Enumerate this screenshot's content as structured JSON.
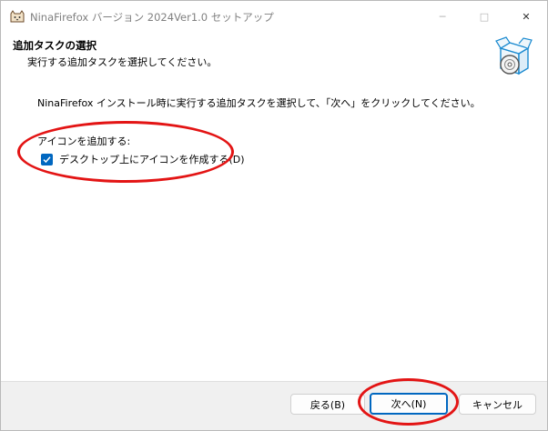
{
  "window": {
    "title": "NinaFirefox バージョン 2024Ver1.0 セットアップ",
    "app_icon": "cat-app-icon",
    "controls": {
      "minimize": "─",
      "maximize": "□",
      "close": "✕"
    }
  },
  "header": {
    "title": "追加タスクの選択",
    "subtitle": "実行する追加タスクを選択してください。",
    "icon": "setup-box-disc-icon"
  },
  "content": {
    "instruction": "NinaFirefox インストール時に実行する追加タスクを選択して、「次へ」をクリックしてください。",
    "group_label": "アイコンを追加する:",
    "tasks": [
      {
        "label": "デスクトップ上にアイコンを作成する(D)",
        "checked": true
      }
    ]
  },
  "footer": {
    "back_label": "戻る(B)",
    "next_label": "次へ(N)",
    "cancel_label": "キャンセル"
  },
  "annotations": {
    "highlight_color": "#e31414"
  },
  "colors": {
    "accent": "#0067c0"
  }
}
